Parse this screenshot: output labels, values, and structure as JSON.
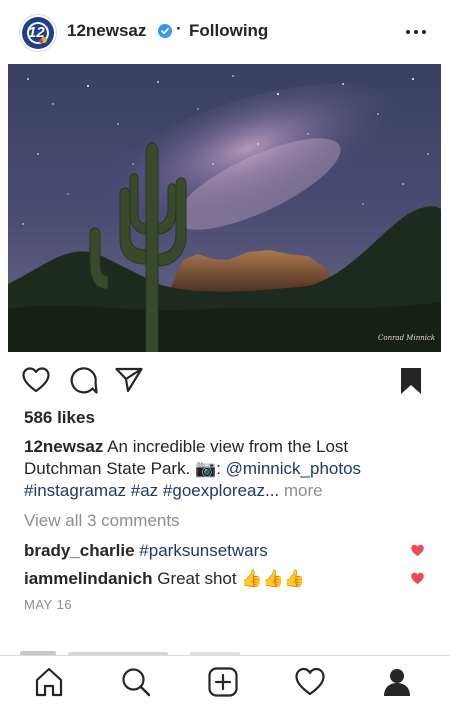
{
  "header": {
    "avatar_text": "12",
    "username": "12newsaz",
    "separator": "·",
    "follow_status": "Following",
    "icons": {
      "verified": "verified-badge-icon",
      "more": "more-options-icon"
    }
  },
  "photo": {
    "description_icon": "milky-way-saguaro-photo",
    "watermark": "Conrad Minnick"
  },
  "actions": {
    "icons": [
      "heart-icon",
      "comment-icon",
      "share-icon",
      "bookmark-icon"
    ]
  },
  "likes": "586 likes",
  "caption": {
    "username": "12newsaz",
    "text_1": " An incredible view from the Lost Dutchman State Park. ",
    "camera_emoji": "📷",
    "text_2": ": ",
    "mention": "@minnick_photos",
    "hashtags": "#instagramaz #az #goexploreaz",
    "ellipsis": "...",
    "more": "more"
  },
  "view_comments": "View all 3 comments",
  "comments": [
    {
      "username": "brady_charlie",
      "text": "#parksunsetwars",
      "is_link": true
    },
    {
      "username": "iammelindanich",
      "text": "Great shot 👍👍👍",
      "is_link": false
    }
  ],
  "date": "MAY 16",
  "bottom_nav": {
    "items": [
      "home-icon",
      "search-icon",
      "new-post-icon",
      "activity-icon",
      "profile-icon"
    ]
  },
  "colors": {
    "text": "#262626",
    "secondary": "#8e8e8e",
    "link": "#1e3a6b",
    "verified": "#3897f0",
    "like_red": "#ed4956"
  }
}
